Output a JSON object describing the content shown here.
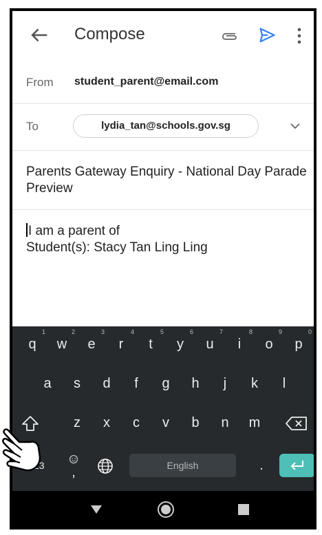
{
  "appbar": {
    "title": "Compose",
    "icons": [
      "back-arrow-icon",
      "attachment-icon",
      "send-icon",
      "more-vert-icon"
    ],
    "send_color": "#3b82f6"
  },
  "from": {
    "label": "From",
    "value": "student_parent@email.com"
  },
  "to": {
    "label": "To",
    "recipient": "lydia_tan@schools.gov.sg"
  },
  "subject": "Parents Gateway Enquiry - National Day Parade Preview",
  "body": {
    "lines": [
      "I am a parent of",
      "Student(s): Stacy Tan Ling Ling"
    ]
  },
  "keyboard": {
    "row1": [
      {
        "key": "q",
        "hint": "1"
      },
      {
        "key": "w",
        "hint": "2"
      },
      {
        "key": "e",
        "hint": "3"
      },
      {
        "key": "r",
        "hint": "4"
      },
      {
        "key": "t",
        "hint": "5"
      },
      {
        "key": "y",
        "hint": "6"
      },
      {
        "key": "u",
        "hint": "7"
      },
      {
        "key": "i",
        "hint": "8"
      },
      {
        "key": "o",
        "hint": "9"
      },
      {
        "key": "p",
        "hint": "0"
      }
    ],
    "row2": [
      "a",
      "s",
      "d",
      "f",
      "g",
      "h",
      "j",
      "k",
      "l"
    ],
    "row3": [
      "z",
      "x",
      "c",
      "v",
      "b",
      "n",
      "m"
    ],
    "symbols_key": "?123",
    "emoji_key": ",",
    "space_label": "English",
    "period_key": ".",
    "background": "#262a2d",
    "enter_color": "#4ebfb6"
  },
  "navbar": {
    "icons": [
      "nav-back-icon",
      "nav-home-icon",
      "nav-recents-icon"
    ]
  }
}
